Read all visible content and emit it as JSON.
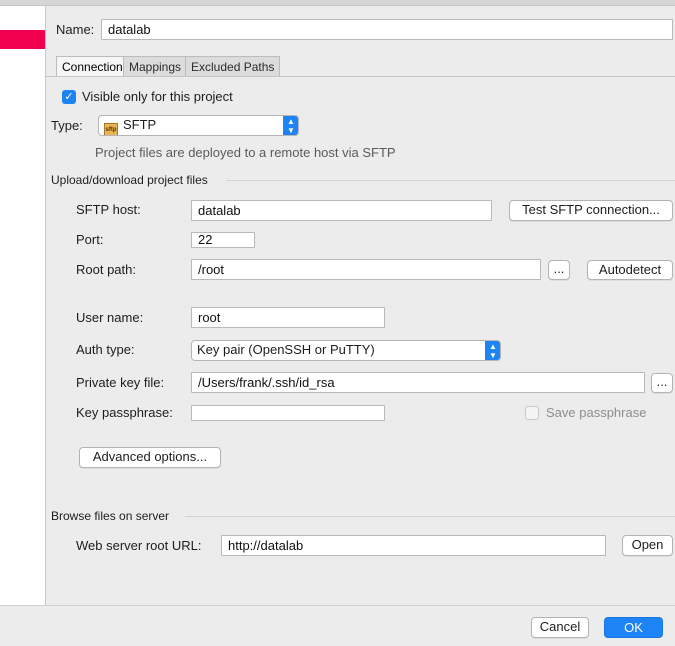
{
  "name": {
    "label": "Name:",
    "value": "datalab"
  },
  "tabs": [
    {
      "label": "Connection",
      "active": true
    },
    {
      "label": "Mappings",
      "active": false
    },
    {
      "label": "Excluded Paths",
      "active": false
    }
  ],
  "visible_only": {
    "label": "Visible only for this project",
    "checked": true
  },
  "type": {
    "label": "Type:",
    "value": "SFTP",
    "description": "Project files are deployed to a remote host via SFTP",
    "icon": "sftp-icon"
  },
  "upload_group": {
    "title": "Upload/download project files"
  },
  "sftp_host": {
    "label": "SFTP host:",
    "value": "datalab",
    "test_button": "Test SFTP connection..."
  },
  "port": {
    "label": "Port:",
    "value": "22"
  },
  "root_path": {
    "label": "Root path:",
    "value": "/root",
    "browse": "...",
    "autodetect": "Autodetect"
  },
  "user_name": {
    "label": "User name:",
    "value": "root"
  },
  "auth_type": {
    "label": "Auth type:",
    "value": "Key pair (OpenSSH or PuTTY)"
  },
  "private_key": {
    "label": "Private key file:",
    "value": "/Users/frank/.ssh/id_rsa",
    "browse": "..."
  },
  "key_passphrase": {
    "label": "Key passphrase:",
    "value": "",
    "save_label": "Save passphrase",
    "save_checked": false
  },
  "advanced_button": "Advanced options...",
  "browse_group": {
    "title": "Browse files on server"
  },
  "web_root": {
    "label": "Web server root URL:",
    "value": "http://datalab",
    "open_button": "Open"
  },
  "footer": {
    "cancel": "Cancel",
    "ok": "OK"
  },
  "colors": {
    "accent": "#1e84f5",
    "sidebar_selection": "#f0004e"
  }
}
